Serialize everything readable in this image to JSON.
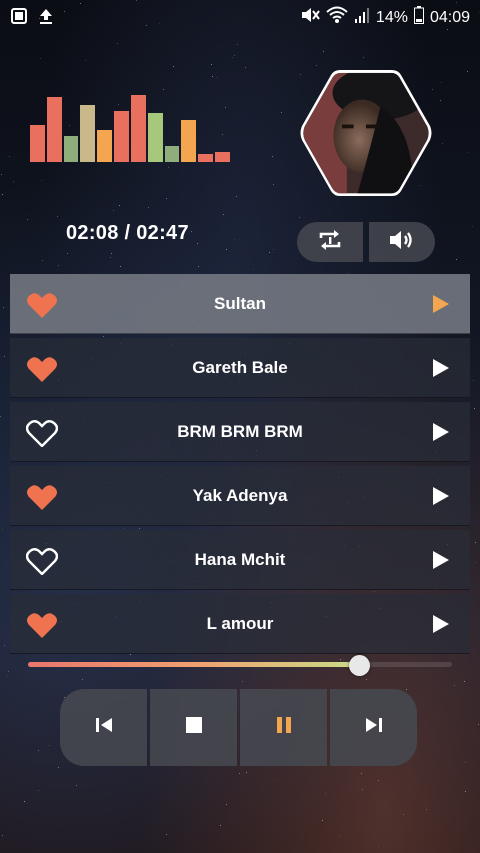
{
  "status_bar": {
    "battery": "14%",
    "time": "04:09",
    "icons": [
      "gallery-icon",
      "upload-icon",
      "mute-icon",
      "wifi-icon",
      "signal-icon",
      "battery-icon"
    ]
  },
  "equalizer": {
    "levels": [
      0.55,
      0.95,
      0.38,
      0.84,
      0.47,
      0.75,
      0.98,
      0.72,
      0.23,
      0.62,
      0.12,
      0.15
    ],
    "colors": [
      "#e96f5f",
      "#e96f5f",
      "#8fae7b",
      "#c9b98a",
      "#f3a64f",
      "#e96f5f",
      "#e96f5f",
      "#a7c77a",
      "#8fae7b",
      "#f3a64f",
      "#e96f5f",
      "#e96f5f"
    ]
  },
  "player": {
    "time_display": "02:08 / 02:47",
    "progress": 0.78
  },
  "songs": [
    {
      "title": "Sultan",
      "favorite": true,
      "active": true
    },
    {
      "title": "Gareth Bale",
      "favorite": true,
      "active": false
    },
    {
      "title": "BRM BRM BRM",
      "favorite": false,
      "active": false
    },
    {
      "title": "Yak Adenya",
      "favorite": true,
      "active": false
    },
    {
      "title": "Hana Mchit",
      "favorite": false,
      "active": false
    },
    {
      "title": "L amour",
      "favorite": true,
      "active": false
    }
  ],
  "colors": {
    "accent": "#f0734f",
    "active_play": "#f3a64f",
    "pause": "#f3a64f"
  }
}
